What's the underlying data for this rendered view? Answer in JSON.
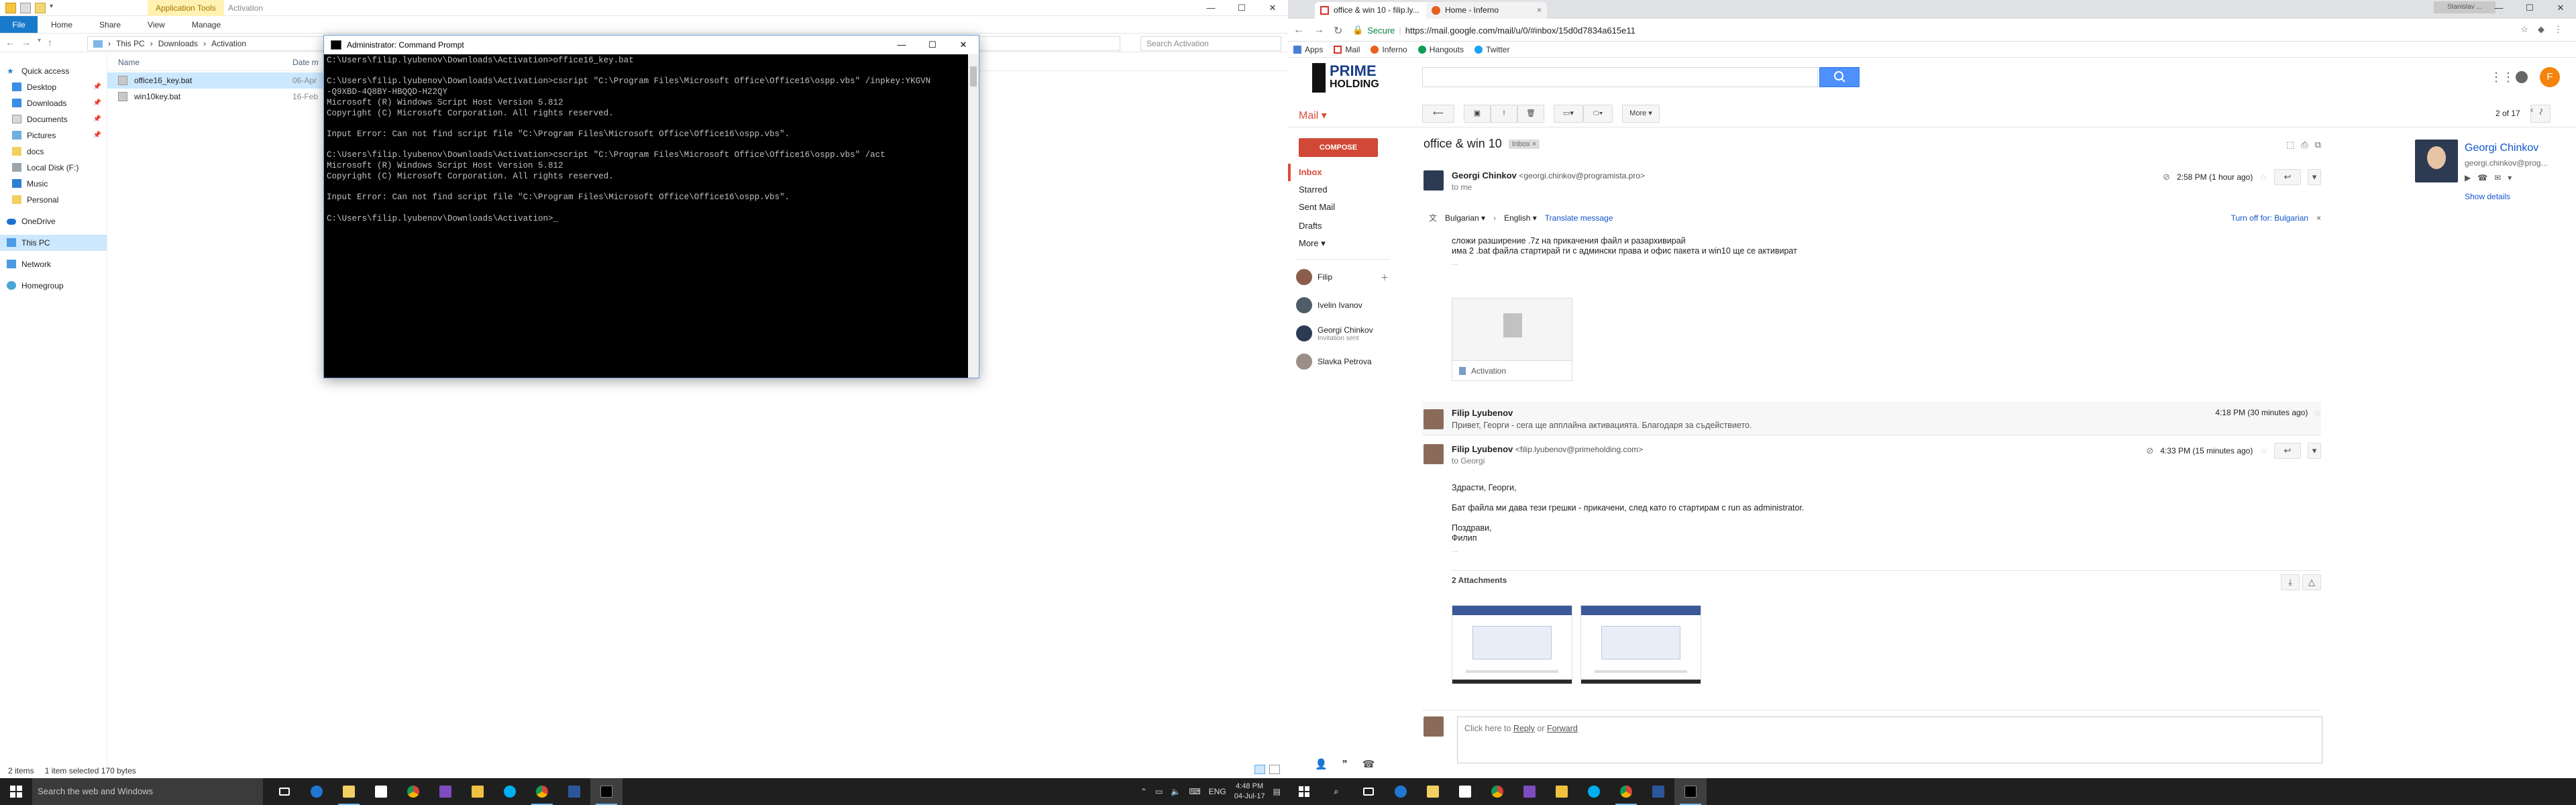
{
  "explorer": {
    "contextual_tab": "Application Tools",
    "window_name": "Activation",
    "controls": [
      "—",
      "☐",
      "✕"
    ],
    "ribbon": {
      "file": "File",
      "tabs": [
        "Home",
        "Share",
        "View",
        "Manage"
      ]
    },
    "breadcrumb": [
      "This PC",
      "Downloads",
      "Activation"
    ],
    "search_placeholder": "Search Activation",
    "nav": {
      "quick_access": "Quick access",
      "pinned": [
        "Desktop",
        "Downloads",
        "Documents",
        "Pictures"
      ],
      "others": [
        "docs",
        "Local Disk (F:)",
        "Music",
        "Personal"
      ],
      "onedrive": "OneDrive",
      "this_pc": "This PC",
      "network": "Network",
      "homegroup": "Homegroup"
    },
    "columns": {
      "name": "Name",
      "date": "Date m"
    },
    "files": [
      {
        "name": "office16_key.bat",
        "date": "06-Apr"
      },
      {
        "name": "win10key.bat",
        "date": "16-Feb"
      }
    ],
    "status": {
      "items": "2 items",
      "selected": "1 item selected  170 bytes"
    }
  },
  "cmd": {
    "title": "Administrator: Command Prompt",
    "lines": [
      "C:\\Users\\filip.lyubenov\\Downloads\\Activation>office16_key.bat",
      "",
      "C:\\Users\\filip.lyubenov\\Downloads\\Activation>cscript \"C:\\Program Files\\Microsoft Office\\Office16\\ospp.vbs\" /inpkey:YKGVN",
      "-Q9XBD-4Q8BY-HBQQD-H22QY",
      "Microsoft (R) Windows Script Host Version 5.812",
      "Copyright (C) Microsoft Corporation. All rights reserved.",
      "",
      "Input Error: Can not find script file \"C:\\Program Files\\Microsoft Office\\Office16\\ospp.vbs\".",
      "",
      "C:\\Users\\filip.lyubenov\\Downloads\\Activation>cscript \"C:\\Program Files\\Microsoft Office\\Office16\\ospp.vbs\" /act",
      "Microsoft (R) Windows Script Host Version 5.812",
      "Copyright (C) Microsoft Corporation. All rights reserved.",
      "",
      "Input Error: Can not find script file \"C:\\Program Files\\Microsoft Office\\Office16\\ospp.vbs\".",
      "",
      "C:\\Users\\filip.lyubenov\\Downloads\\Activation>_"
    ]
  },
  "chrome": {
    "tabs": [
      {
        "title": "office & win 10 - filip.ly..."
      },
      {
        "title": "Home - Inferno"
      }
    ],
    "user_chip": "Stanislav ...",
    "url": "https://mail.google.com/mail/u/0/#inbox/15d0d7834a615e11",
    "secure_label": "Secure",
    "bookmarks": [
      "Apps",
      "Mail",
      "Inferno",
      "Hangouts",
      "Twitter"
    ]
  },
  "gmail": {
    "logo": {
      "line1": "PRIME",
      "line2": "HOLDING"
    },
    "avatar_letter": "F",
    "mail_label": "Mail ▾",
    "toolbar": {
      "more": "More ▾",
      "pager": "2 of 17"
    },
    "compose": "COMPOSE",
    "folders": [
      "Inbox",
      "Starred",
      "Sent Mail",
      "Drafts",
      "More ▾"
    ],
    "hangouts": [
      {
        "name": "Filip",
        "sub": ""
      },
      {
        "name": "Ivelin Ivanov",
        "sub": ""
      },
      {
        "name": "Georgi Chinkov",
        "sub": "Invitation sent"
      },
      {
        "name": "Slavka Petrova",
        "sub": ""
      }
    ],
    "thread": {
      "subject": "office & win 10",
      "label": "Inbox ×",
      "msg1": {
        "sender": "Georgi Chinkov",
        "email": "<georgi.chinkov@programista.pro>",
        "to": "to me",
        "time": "2:58 PM (1 hour ago)",
        "lang_from": "Bulgarian ▾",
        "lang_to": "English ▾",
        "translate": "Translate message",
        "turn_off": "Turn off for: Bulgarian",
        "body": [
          "сложи разширение .7z на прикачения файл и разархивирай",
          "има 2 .bat файла стартирай ги с админски права и офис пакета и win10 ще се активират"
        ],
        "ellipsis": "...",
        "attachment": "Activation"
      },
      "msg2": {
        "sender": "Filip Lyubenov",
        "snippet": "Привет, Георги - сега ще апплайна активацията. Благодаря за съдействието.",
        "time": "4:18 PM (30 minutes ago)"
      },
      "msg3": {
        "sender": "Filip Lyubenov",
        "email": "<filip.lyubenov@primeholding.com>",
        "to": "to Georgi",
        "time": "4:33 PM (15 minutes ago)",
        "body": [
          "Здрасти, Георги,",
          "",
          "Бат файла ми дава тези грешки - прикачени, след като го стартирам с run as administrator.",
          "",
          "Поздрави,",
          "Филип"
        ],
        "ellipsis": "..."
      },
      "attachments_title": "2 Attachments",
      "reply": {
        "prefix": "Click here to ",
        "reply": "Reply",
        "or": " or ",
        "forward": "Forward"
      }
    },
    "profile": {
      "name": "Georgi Chinkov",
      "email": "georgi.chinkov@prog...",
      "details": "Show details"
    }
  },
  "taskbar": {
    "search": "Search the web and Windows",
    "tray": {
      "lang": "ENG",
      "time": "4:48 PM",
      "date": "04-Jul-17"
    }
  }
}
